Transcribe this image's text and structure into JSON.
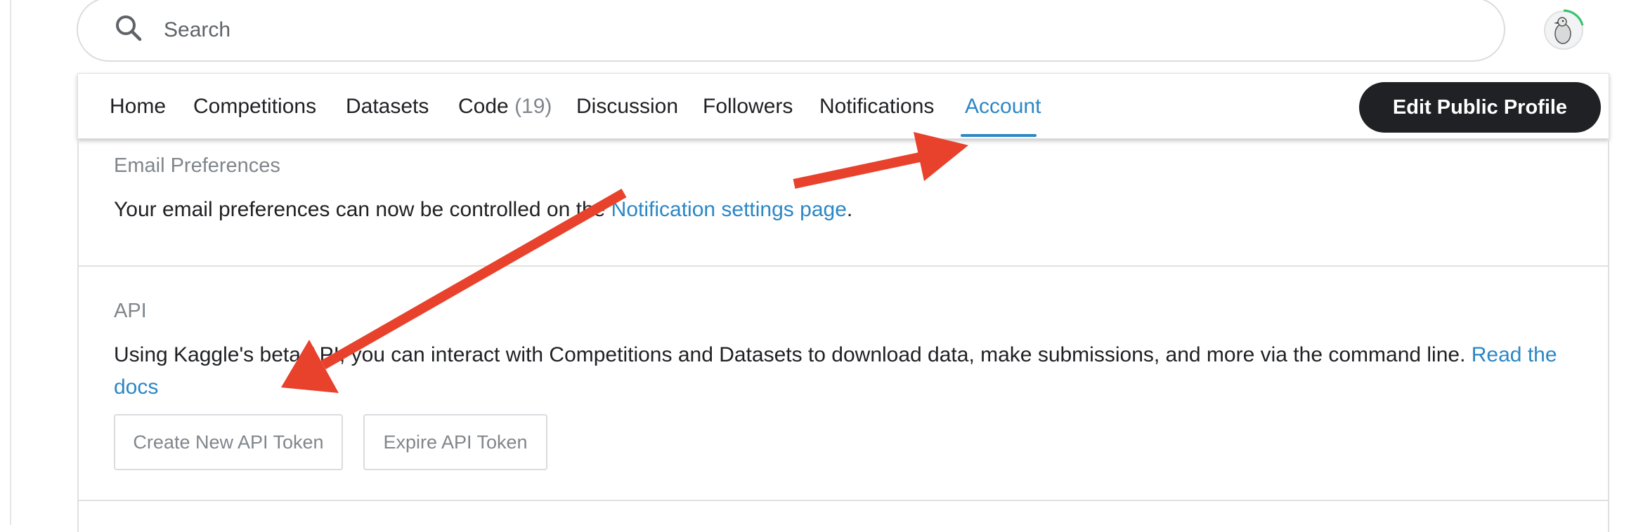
{
  "search": {
    "placeholder": "Search"
  },
  "nav": {
    "tabs": [
      {
        "label": "Home"
      },
      {
        "label": "Competitions"
      },
      {
        "label": "Datasets"
      },
      {
        "label": "Code",
        "count": "(19)"
      },
      {
        "label": "Discussion"
      },
      {
        "label": "Followers"
      },
      {
        "label": "Notifications"
      },
      {
        "label": "Account",
        "active": true
      }
    ],
    "edit_profile_label": "Edit Public Profile"
  },
  "email_prefs": {
    "title": "Email Preferences",
    "text": "Your email preferences can now be controlled on the ",
    "link": "Notification settings page",
    "suffix": "."
  },
  "api": {
    "title": "API",
    "text": "Using Kaggle's beta API, you can interact with Competitions and Datasets to download data, make submissions, and more via the command line. ",
    "link": "Read the docs",
    "create_token_label": "Create New API Token",
    "expire_token_label": "Expire API Token"
  },
  "colors": {
    "accent": "#2b87c5",
    "annotation_arrow": "#e8412c",
    "dark_button": "#202124"
  },
  "icons": {
    "search": "search-icon",
    "avatar": "goose-avatar-icon",
    "annotation": "red-arrow-icon"
  }
}
